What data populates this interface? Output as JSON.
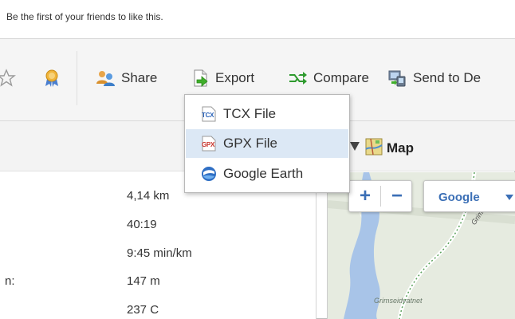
{
  "social": {
    "like_text": "Be the first of your friends to like this."
  },
  "toolbar": {
    "share_label": "Share",
    "export_label": "Export",
    "compare_label": "Compare",
    "send_label": "Send to De"
  },
  "export_menu": {
    "items": [
      {
        "icon_text": "TCX",
        "label": "TCX File"
      },
      {
        "icon_text": "GPX",
        "label": "GPX File",
        "highlighted": true
      },
      {
        "icon_text": "",
        "label": "Google Earth"
      }
    ]
  },
  "stats": {
    "partial_label": "n:",
    "values": [
      "4,14 km",
      "40:19",
      "9:45 min/km",
      "147 m",
      "237 C"
    ]
  },
  "map": {
    "title": "Map",
    "zoom_in": "+",
    "zoom_out": "−",
    "type_label": "Google",
    "road_label": "Grimseidvegen",
    "lake_label": "Grimseidvatnet"
  },
  "colors": {
    "accent_blue": "#3b6fb6",
    "highlight": "#dce8f5",
    "lake": "#a8c4e8"
  }
}
